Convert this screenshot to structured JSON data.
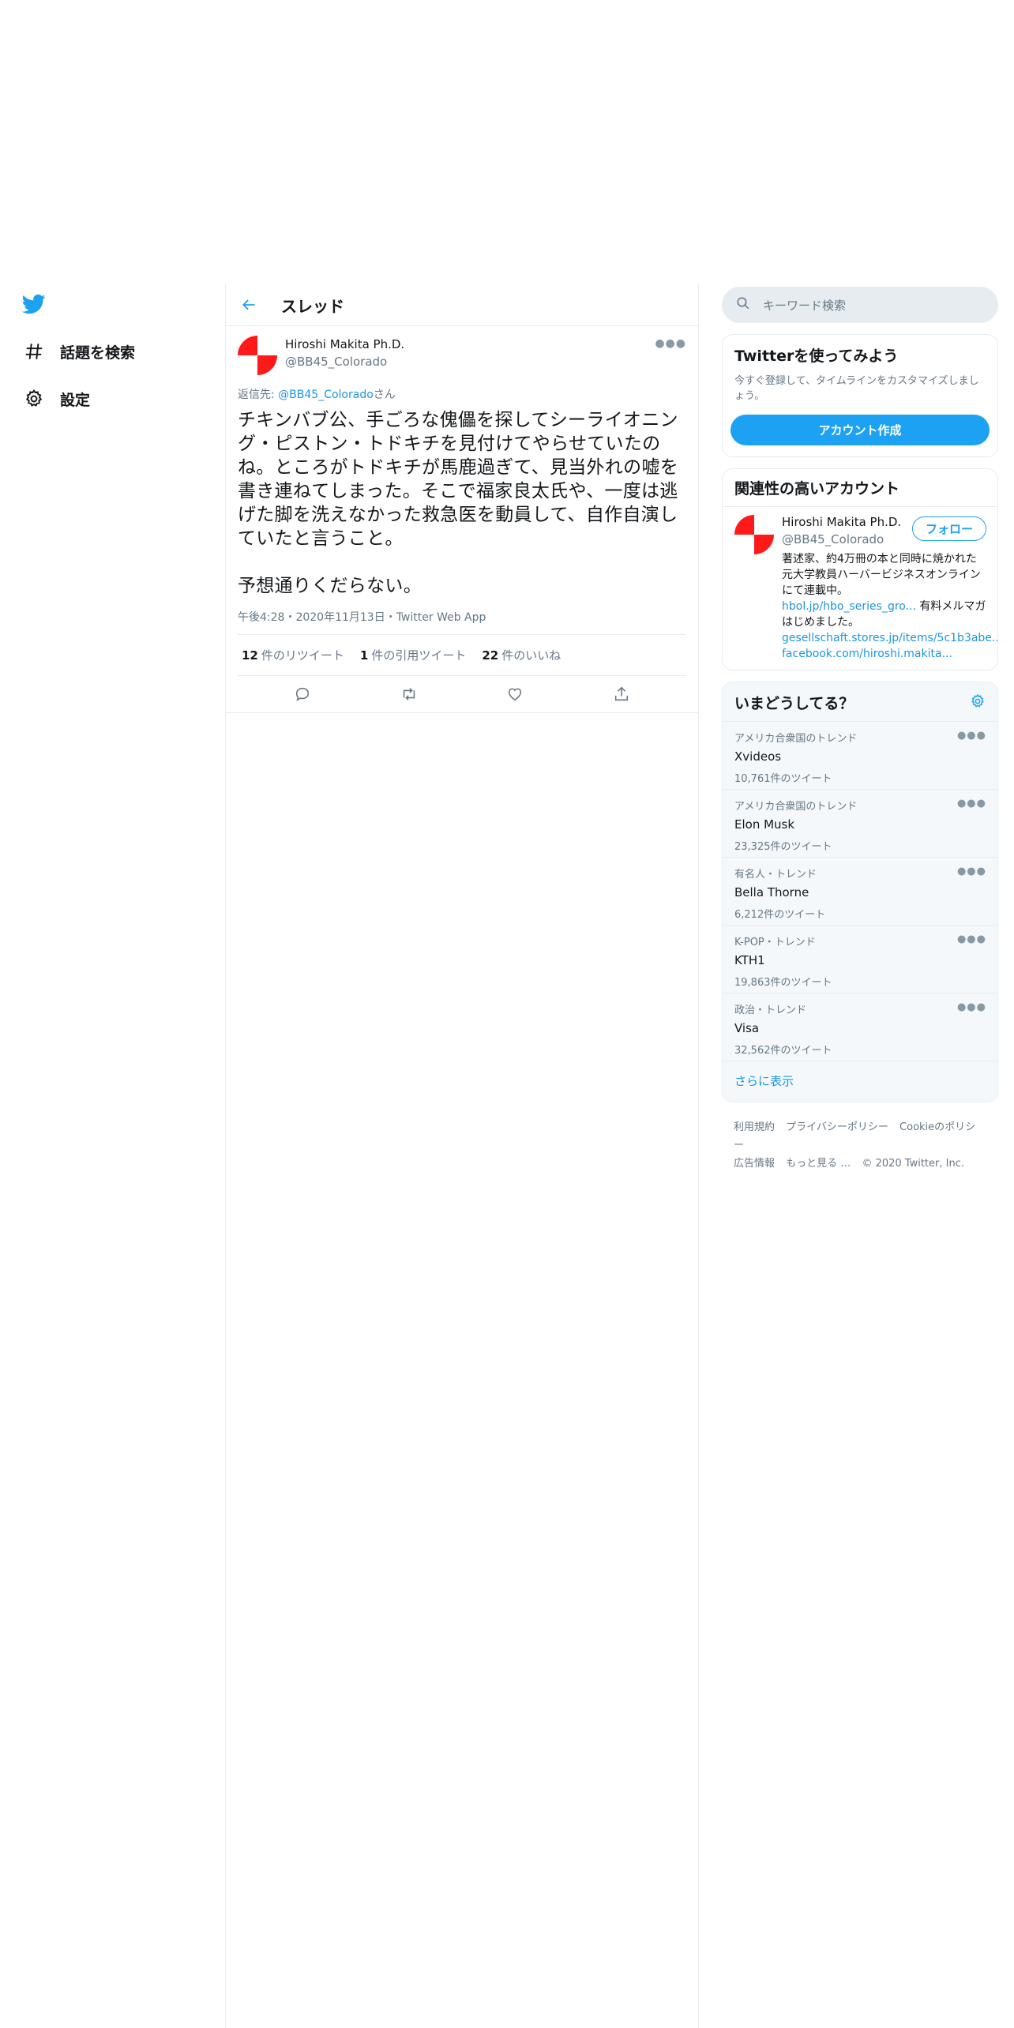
{
  "nav": {
    "items": [
      {
        "label": "話題を検索",
        "icon": "hashtag-icon"
      },
      {
        "label": "設定",
        "icon": "gear-icon"
      }
    ]
  },
  "main": {
    "title": "スレッド"
  },
  "tweet": {
    "name": "Hiroshi Makita Ph.D.",
    "handle": "@BB45_Colorado",
    "reply_prefix": "返信先: ",
    "reply_handle": "@BB45_Colorado",
    "reply_suffix": "さん",
    "text": "チキンバブ公、手ごろな傀儡を探してシーライオニング・ピストン・トドキチを見付けてやらせていたのね。ところがトドキチが馬鹿過ぎて、見当外れの嘘を書き連ねてしまった。そこで福家良太氏や、一度は逃げた脚を洗えなかった救急医を動員して、自作自演していたと言うこと。\n\n予想通りくだらない。",
    "meta": "午後4:28・2020年11月13日・Twitter Web App",
    "retweets": "12",
    "retweets_label": "件のリツイート",
    "quotes": "1",
    "quotes_label": "件の引用ツイート",
    "likes": "22",
    "likes_label": "件のいいね"
  },
  "search": {
    "placeholder": "キーワード検索"
  },
  "signup": {
    "title": "Twitterを使ってみよう",
    "subtitle": "今すぐ登録して、タイムラインをカスタマイズしましょう。",
    "button": "アカウント作成"
  },
  "related": {
    "title": "関連性の高いアカウント",
    "name": "Hiroshi Makita Ph.D.",
    "handle": "@BB45_Colorado",
    "follow": "フォロー",
    "bio_1": "著述家、約4万冊の本と同時に焼かれた元大学教員ハーバービジネスオンラインにて連載中。",
    "bio_link1": "hbol.jp/hbo_series_gro...",
    "bio_2": " 有料メルマガはじめました。",
    "bio_link2": "gesellschaft.stores.jp/items/5c1b3abe...",
    "bio_link3": "facebook.com/hiroshi.makita..."
  },
  "trends": {
    "title": "いまどうしてる？",
    "items": [
      {
        "context": "アメリカ合衆国のトレンド",
        "name": "Xvideos",
        "count": "10,761件のツイート"
      },
      {
        "context": "アメリカ合衆国のトレンド",
        "name": "Elon Musk",
        "count": "23,325件のツイート"
      },
      {
        "context": "有名人・トレンド",
        "name": "Bella Thorne",
        "count": "6,212件のツイート"
      },
      {
        "context": "K-POP・トレンド",
        "name": "KTH1",
        "count": "19,863件のツイート"
      },
      {
        "context": "政治・トレンド",
        "name": "Visa",
        "count": "32,562件のツイート"
      }
    ],
    "show_more": "さらに表示"
  },
  "footer": {
    "links": [
      "利用規約",
      "プライバシーポリシー",
      "Cookieのポリシー",
      "広告情報",
      "もっと見る …",
      "© 2020 Twitter, Inc."
    ]
  },
  "colors": {
    "accent": "#1da1f2",
    "link": "#1b95e0",
    "avatar_red": "#ff1a1a"
  }
}
